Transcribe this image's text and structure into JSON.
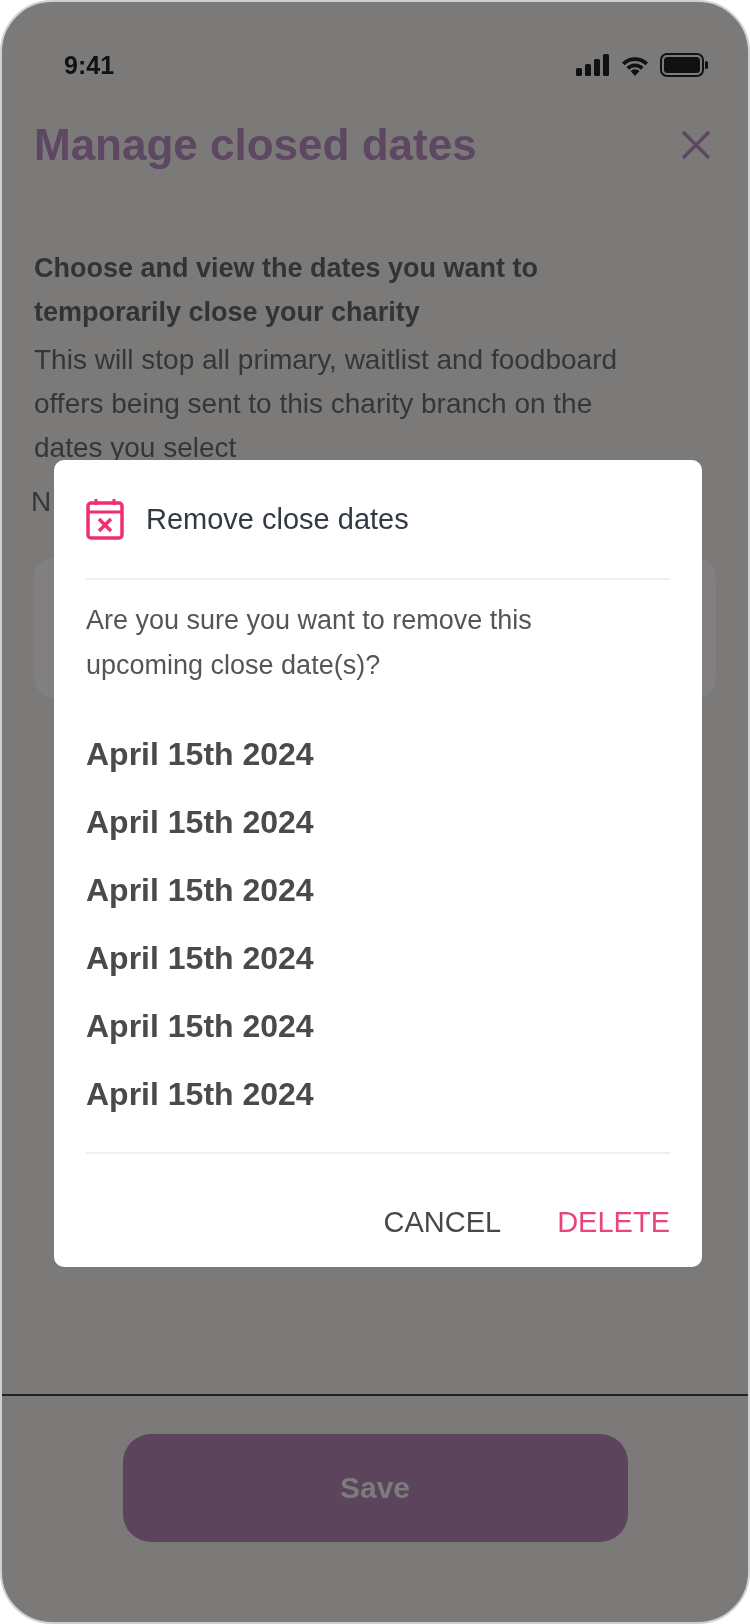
{
  "status_bar": {
    "time": "9:41"
  },
  "header": {
    "title": "Manage closed dates"
  },
  "intro": {
    "heading": "Choose and view the dates you want to temporarily close your charity",
    "body": "This will stop all primary, waitlist and foodboard offers being sent to this charity branch on the dates you select",
    "note": "N"
  },
  "footer": {
    "save_label": "Save",
    "save_disabled": true
  },
  "dialog": {
    "title": "Remove close dates",
    "question": "Are you sure you want to remove this upcoming close date(s)?",
    "dates": [
      "April 15th 2024",
      "April 15th 2024",
      "April 15th 2024",
      "April 15th 2024",
      "April 15th 2024",
      "April 15th 2024"
    ],
    "actions": [
      {
        "label": "CANCEL",
        "kind": "neutral"
      },
      {
        "label": "DELETE",
        "kind": "danger"
      }
    ]
  }
}
